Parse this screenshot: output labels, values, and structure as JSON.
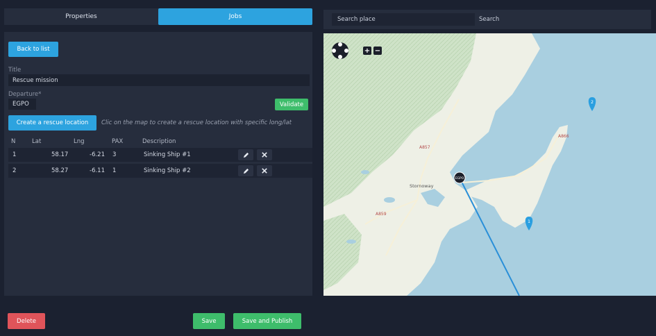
{
  "tabs": [
    {
      "label": "Properties",
      "active": false
    },
    {
      "label": "Jobs",
      "active": true
    }
  ],
  "form": {
    "back_label": "Back to list",
    "title_label": "Title",
    "title_value": "Rescue mission",
    "departure_label": "Departure*",
    "departure_value": "EGPO",
    "validate_label": "Validate",
    "create_label": "Create a rescue location",
    "hint": "Clic on the map to create a rescue location with specific long/lat"
  },
  "table": {
    "columns": [
      "N",
      "Lat",
      "Lng",
      "PAX",
      "Description"
    ],
    "rows": [
      {
        "n": "1",
        "lat": "58.17",
        "lng": "-6.21",
        "pax": "3",
        "desc": "Sinking Ship #1"
      },
      {
        "n": "2",
        "lat": "58.27",
        "lng": "-6.11",
        "pax": "1",
        "desc": "Sinking Ship #2"
      }
    ]
  },
  "footer": {
    "delete_label": "Delete",
    "save_label": "Save",
    "publish_label": "Save and Publish"
  },
  "search": {
    "placeholder": "Search place",
    "button_label": "Search"
  },
  "map": {
    "zoom_in": "+",
    "zoom_out": "−",
    "airport_label": "EGPO",
    "town_label": "Stornoway",
    "road_labels": [
      "A857",
      "A866",
      "A859"
    ],
    "marker_1": "1",
    "marker_2": "2",
    "colors": {
      "water": "#a9cfe0",
      "land": "#eef0e6",
      "moor": "#cfe3c8",
      "route": "#2a8fd8",
      "marker": "#2a9fe0"
    }
  },
  "icons": {
    "edit": "pencil-icon",
    "remove": "close-icon",
    "pan": "pan-arrows-icon"
  }
}
